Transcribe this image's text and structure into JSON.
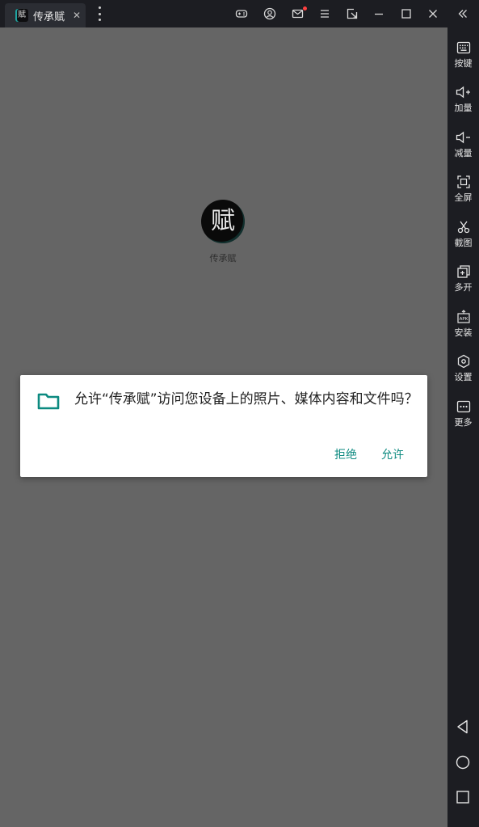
{
  "titlebar": {
    "tab_title": "传承赋",
    "tab_icon_glyph": "赋",
    "close_glyph": "✕",
    "icons": [
      "gamepad-icon",
      "account-icon",
      "mail-icon",
      "menu-icon",
      "window-pin-icon",
      "minimize-icon",
      "maximize-icon",
      "close-icon",
      "collapse-panel-icon"
    ],
    "mail_badge_color": "#ff4040"
  },
  "screen": {
    "app_icon_glyph": "赋",
    "app_label": "传承赋",
    "background_color": "#656565"
  },
  "dialog": {
    "message": "允许“传承赋”访问您设备上的照片、媒体内容和文件吗？",
    "deny_label": "拒绝",
    "allow_label": "允许",
    "accent_color": "#0c8a80"
  },
  "sidepanel": {
    "items": [
      {
        "label": "按键",
        "icon": "keyboard-icon"
      },
      {
        "label": "加量",
        "icon": "volume-up-icon"
      },
      {
        "label": "减量",
        "icon": "volume-down-icon"
      },
      {
        "label": "全屏",
        "icon": "fullscreen-icon"
      },
      {
        "label": "截图",
        "icon": "scissors-icon"
      },
      {
        "label": "多开",
        "icon": "multi-instance-icon"
      },
      {
        "label": "安装",
        "icon": "apk-install-icon"
      },
      {
        "label": "设置",
        "icon": "settings-icon"
      },
      {
        "label": "更多",
        "icon": "more-icon"
      }
    ],
    "nav": [
      "back-icon",
      "home-icon",
      "recents-icon"
    ]
  }
}
